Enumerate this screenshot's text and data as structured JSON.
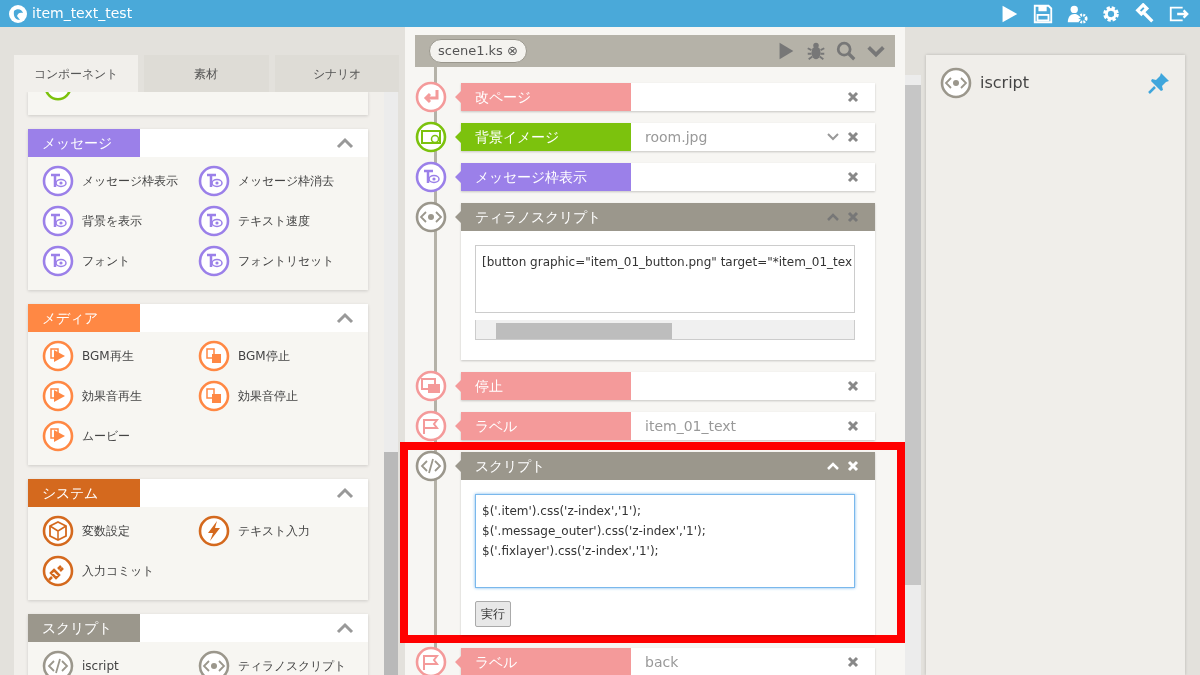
{
  "app": {
    "title": "item_text_test"
  },
  "left_tabs": [
    {
      "label": "コンポーネント",
      "selected": true
    },
    {
      "label": "素材",
      "selected": false
    },
    {
      "label": "シナリオ",
      "selected": false
    }
  ],
  "palette": [
    {
      "title": "メッセージ",
      "color": "#9b80e9",
      "expanded": true,
      "items": [
        "メッセージ枠表示",
        "メッセージ枠消去",
        "背景を表示",
        "テキスト速度",
        "フォント",
        "フォントリセット"
      ]
    },
    {
      "title": "メディア",
      "color": "#ff8844",
      "expanded": true,
      "items": [
        "BGM再生",
        "BGM停止",
        "効果音再生",
        "効果音停止",
        "ムービー"
      ]
    },
    {
      "title": "システム",
      "color": "#d4691e",
      "expanded": true,
      "items": [
        "変数設定",
        "テキスト入力",
        "入力コミット"
      ]
    },
    {
      "title": "スクリプト",
      "color": "#9b978c",
      "expanded": true,
      "items": [
        "iscript",
        "ティラノスクリプト"
      ]
    }
  ],
  "editor": {
    "file_tab": {
      "label": "scene1.ks",
      "close": "⊗"
    },
    "tags": [
      {
        "kind": "tag",
        "label": "改ページ",
        "color": "#f49a9a",
        "highlighted": false
      },
      {
        "kind": "select",
        "label": "背景イメージ",
        "color": "#7cc20d",
        "value": "room.jpg",
        "highlighted": false
      },
      {
        "kind": "tag",
        "label": "メッセージ枠表示",
        "color": "#9b80e9",
        "highlighted": false
      },
      {
        "kind": "code",
        "label": "ティラノスクリプト",
        "color": "#9b978c",
        "expanded": true,
        "focused": false,
        "code": "[button graphic=\"item_01_button.png\" target=\"*item_01_tex",
        "highlighted": false
      },
      {
        "kind": "tag",
        "label": "停止",
        "color": "#f49a9a",
        "highlighted": false
      },
      {
        "kind": "tag",
        "label": "ラベル",
        "color": "#f49a9a",
        "value": "item_01_text",
        "highlighted": false
      },
      {
        "kind": "code",
        "label": "スクリプト",
        "color": "#9b978c",
        "expanded": true,
        "focused": true,
        "code": "$('.item').css('z-index','1');\n$('.message_outer').css('z-index','1');\n$('.fixlayer').css('z-index','1');",
        "button": "実行",
        "highlighted": true
      },
      {
        "kind": "tag",
        "label": "ラベル",
        "color": "#f49a9a",
        "value": "back",
        "highlighted": false
      }
    ]
  },
  "pinned": {
    "label": "iscript"
  }
}
